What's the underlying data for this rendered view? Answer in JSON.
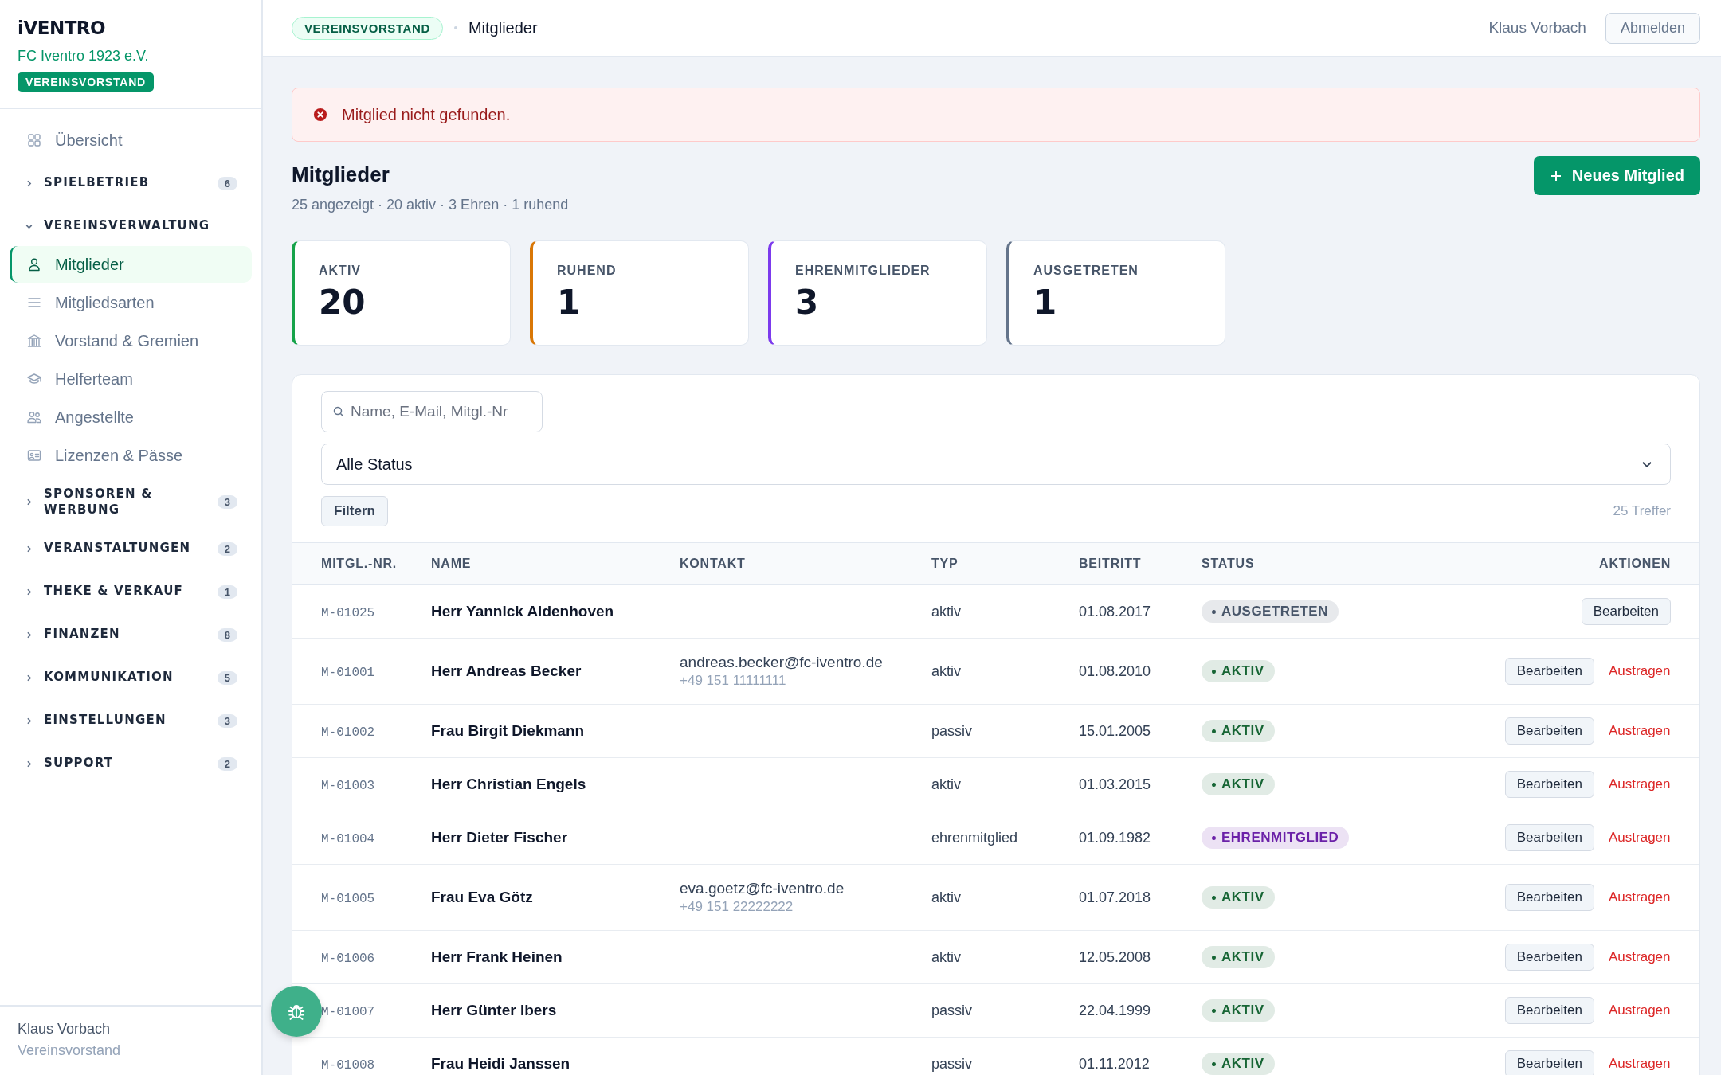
{
  "sidebar": {
    "logo": "iVENTRO",
    "club": "FC Iventro 1923 e.V.",
    "role_badge": "VEREINSVORSTAND",
    "nav": [
      {
        "kind": "link",
        "label": "Übersicht",
        "selected": false
      },
      {
        "kind": "group",
        "label": "SPIELBETRIEB",
        "count": "6",
        "expanded": false
      },
      {
        "kind": "group",
        "label": "VEREINSVERWALTUNG",
        "expanded": true,
        "children": [
          {
            "label": "Mitglieder",
            "selected": true
          },
          {
            "label": "Mitgliedsarten",
            "selected": false
          },
          {
            "label": "Vorstand & Gremien",
            "selected": false
          },
          {
            "label": "Helferteam",
            "selected": false
          },
          {
            "label": "Angestellte",
            "selected": false
          },
          {
            "label": "Lizenzen & Pässe",
            "selected": false
          }
        ]
      },
      {
        "kind": "group",
        "label": "SPONSOREN & WERBUNG",
        "count": "3",
        "expanded": false
      },
      {
        "kind": "group",
        "label": "VERANSTALTUNGEN",
        "count": "2",
        "expanded": false
      },
      {
        "kind": "group",
        "label": "THEKE & VERKAUF",
        "count": "1",
        "expanded": false
      },
      {
        "kind": "group",
        "label": "FINANZEN",
        "count": "8",
        "expanded": false
      },
      {
        "kind": "group",
        "label": "KOMMUNIKATION",
        "count": "5",
        "expanded": false
      },
      {
        "kind": "group",
        "label": "EINSTELLUNGEN",
        "count": "3",
        "expanded": false
      },
      {
        "kind": "group",
        "label": "SUPPORT",
        "count": "2",
        "expanded": false
      }
    ],
    "user": {
      "name": "Klaus Vorbach",
      "role": "Vereinsvorstand"
    }
  },
  "header": {
    "breadcrumb_badge": "VEREINSVORSTAND",
    "page": "Mitglieder",
    "user": "Klaus Vorbach",
    "logout": "Abmelden"
  },
  "alert": {
    "message": "Mitglied nicht gefunden."
  },
  "page": {
    "title": "Mitglieder",
    "subtitle": "25 angezeigt · 20 aktiv · 3 Ehren · 1 ruhend",
    "new_button": "Neues Mitglied"
  },
  "stats": [
    {
      "label": "AKTIV",
      "value": "20",
      "color": "#16a34a"
    },
    {
      "label": "RUHEND",
      "value": "1",
      "color": "#d97706"
    },
    {
      "label": "EHRENMITGLIEDER",
      "value": "3",
      "color": "#7c3aed"
    },
    {
      "label": "AUSGETRETEN",
      "value": "1",
      "color": "#64748b"
    }
  ],
  "filters": {
    "search": {
      "placeholder": "Name, E-Mail, Mitgl.-Nr"
    },
    "status_select": {
      "value": "Alle Status"
    },
    "filter_button": "Filtern",
    "result_count": "25 Treffer"
  },
  "table": {
    "columns": [
      "MITGL.-NR.",
      "NAME",
      "KONTAKT",
      "TYP",
      "BEITRITT",
      "STATUS",
      "AKTIONEN"
    ],
    "rows": [
      {
        "id": "M-01025",
        "name": "Herr Yannick Aldenhoven",
        "type": "aktiv",
        "joined": "01.08.2017",
        "status": {
          "label": "AUSGETRETEN",
          "color": "#475569"
        },
        "actions": [
          {
            "kind": "edit",
            "label": "Bearbeiten"
          }
        ]
      },
      {
        "id": "M-01001",
        "name": "Herr Andreas Becker",
        "email": "andreas.becker@fc-iventro.de",
        "phone": "+49 151 11111111",
        "type": "aktiv",
        "joined": "01.08.2010",
        "status": {
          "label": "AKTIV",
          "color": "#166534"
        },
        "actions": [
          {
            "kind": "edit",
            "label": "Bearbeiten"
          },
          {
            "kind": "remove",
            "label": "Austragen"
          }
        ]
      },
      {
        "id": "M-01002",
        "name": "Frau Birgit Diekmann",
        "type": "passiv",
        "joined": "15.01.2005",
        "status": {
          "label": "AKTIV",
          "color": "#166534"
        },
        "actions": [
          {
            "kind": "edit",
            "label": "Bearbeiten"
          },
          {
            "kind": "remove",
            "label": "Austragen"
          }
        ]
      },
      {
        "id": "M-01003",
        "name": "Herr Christian Engels",
        "type": "aktiv",
        "joined": "01.03.2015",
        "status": {
          "label": "AKTIV",
          "color": "#166534"
        },
        "actions": [
          {
            "kind": "edit",
            "label": "Bearbeiten"
          },
          {
            "kind": "remove",
            "label": "Austragen"
          }
        ]
      },
      {
        "id": "M-01004",
        "name": "Herr Dieter Fischer",
        "type": "ehrenmitglied",
        "joined": "01.09.1982",
        "status": {
          "label": "EHRENMITGLIED",
          "color": "#6b21a8"
        },
        "actions": [
          {
            "kind": "edit",
            "label": "Bearbeiten"
          },
          {
            "kind": "remove",
            "label": "Austragen"
          }
        ]
      },
      {
        "id": "M-01005",
        "name": "Frau Eva Götz",
        "email": "eva.goetz@fc-iventro.de",
        "phone": "+49 151 22222222",
        "type": "aktiv",
        "joined": "01.07.2018",
        "status": {
          "label": "AKTIV",
          "color": "#166534"
        },
        "actions": [
          {
            "kind": "edit",
            "label": "Bearbeiten"
          },
          {
            "kind": "remove",
            "label": "Austragen"
          }
        ]
      },
      {
        "id": "M-01006",
        "name": "Herr Frank Heinen",
        "type": "aktiv",
        "joined": "12.05.2008",
        "status": {
          "label": "AKTIV",
          "color": "#166534"
        },
        "actions": [
          {
            "kind": "edit",
            "label": "Bearbeiten"
          },
          {
            "kind": "remove",
            "label": "Austragen"
          }
        ]
      },
      {
        "id": "M-01007",
        "name": "Herr Günter Ibers",
        "type": "passiv",
        "joined": "22.04.1999",
        "status": {
          "label": "AKTIV",
          "color": "#166534"
        },
        "actions": [
          {
            "kind": "edit",
            "label": "Bearbeiten"
          },
          {
            "kind": "remove",
            "label": "Austragen"
          }
        ]
      },
      {
        "id": "M-01008",
        "name": "Frau Heidi Janssen",
        "type": "passiv",
        "joined": "01.11.2012",
        "status": {
          "label": "AKTIV",
          "color": "#166534"
        },
        "actions": [
          {
            "kind": "edit",
            "label": "Bearbeiten"
          },
          {
            "kind": "remove",
            "label": "Austragen"
          }
        ]
      }
    ]
  }
}
